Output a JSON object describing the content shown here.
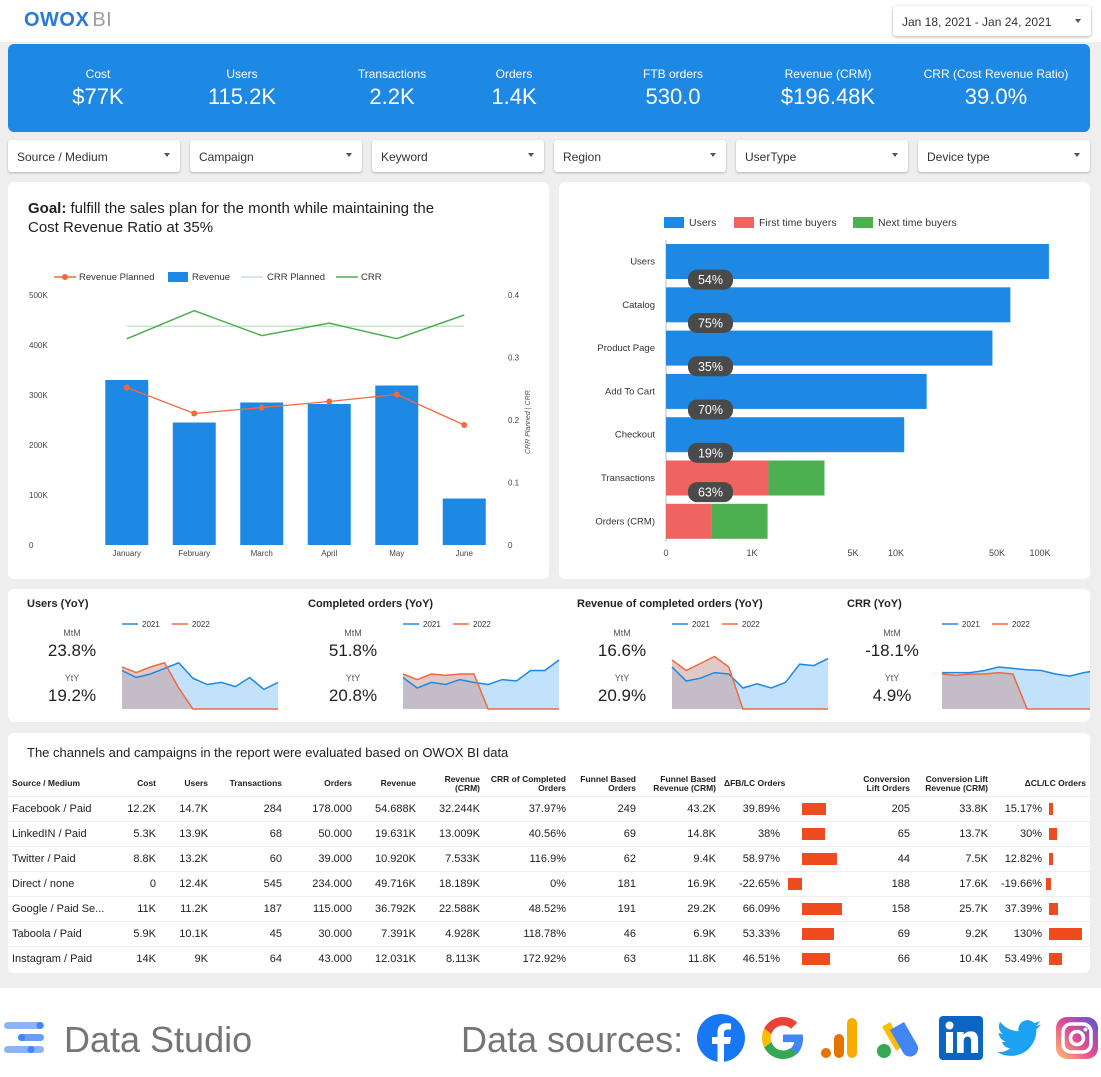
{
  "header": {
    "logo_main": "OWOX",
    "logo_sub": "BI",
    "date_range": "Jan 18, 2021 - Jan 24, 2021"
  },
  "kpis": [
    {
      "label": "Cost",
      "value": "$77K"
    },
    {
      "label": "Users",
      "value": "115.2K"
    },
    {
      "label": "Transactions",
      "value": "2.2K"
    },
    {
      "label": "Orders",
      "value": "1.4K"
    },
    {
      "label": "FTB orders",
      "value": "530.0"
    },
    {
      "label": "Revenue (CRM)",
      "value": "$196.48K"
    },
    {
      "label": "CRR (Cost Revenue Ratio)",
      "value": "39.0%"
    }
  ],
  "filters": [
    "Source / Medium",
    "Campaign",
    "Keyword",
    "Region",
    "UserType",
    "Device type"
  ],
  "goal": {
    "bold": "Goal:",
    "text": " fulfill the sales plan for the month while maintaining the Cost Revenue Ratio at 35%"
  },
  "chart_data": [
    {
      "type": "bar",
      "categories": [
        "January",
        "February",
        "March",
        "April",
        "May",
        "June"
      ],
      "series": [
        {
          "name": "Revenue",
          "type": "bar",
          "axis": "left",
          "values": [
            330000,
            245000,
            285000,
            282000,
            319000,
            93000
          ]
        },
        {
          "name": "Revenue Planned",
          "type": "line",
          "axis": "left",
          "values": [
            315000,
            263000,
            275000,
            287000,
            301000,
            240000
          ]
        },
        {
          "name": "CRR Planned",
          "type": "line",
          "axis": "right",
          "values": [
            0.35,
            0.35,
            0.35,
            0.35,
            0.35,
            0.35
          ]
        },
        {
          "name": "CRR",
          "type": "line",
          "axis": "right",
          "values": [
            0.33,
            0.375,
            0.335,
            0.355,
            0.33,
            0.368
          ]
        }
      ],
      "yticks": [
        "500K",
        "400K",
        "300K",
        "200K",
        "100K",
        "0"
      ],
      "y2ticks": [
        "0.4",
        "0.3",
        "0.2",
        "0.1",
        "0"
      ],
      "ylim": [
        0,
        500000
      ],
      "y2lim": [
        0,
        0.4
      ],
      "y2label": "CRR Planned | CRR",
      "colors": {
        "bar": "#1e88e5",
        "planned": "#f4683c",
        "crr_planned": "#c8e6c9",
        "crr": "#4caf50"
      }
    },
    {
      "type": "bar",
      "orientation": "horizontal",
      "scale": "log",
      "categories": [
        "Users",
        "Catalog",
        "Product Page",
        "Add To Cart",
        "Checkout",
        "Transactions",
        "Orders (CRM)"
      ],
      "series": [
        {
          "name": "Users",
          "values": [
            115200,
            62000,
            46500,
            16300,
            11400,
            null,
            null
          ]
        },
        {
          "name": "First time buyers",
          "values": [
            null,
            null,
            null,
            null,
            null,
            1300,
            530
          ]
        },
        {
          "name": "Next time buyers",
          "values": [
            null,
            null,
            null,
            null,
            null,
            900,
            870
          ]
        }
      ],
      "step_labels": [
        "54%",
        "75%",
        "35%",
        "70%",
        "19%",
        "63%"
      ],
      "xticks": [
        "0",
        "1K",
        "5K",
        "10K",
        "50K",
        "100K"
      ],
      "colors": {
        "users": "#1e88e5",
        "ftb": "#ef6461",
        "ntb": "#4caf50"
      }
    },
    {
      "type": "area",
      "title": "Users (YoY)",
      "series": [
        {
          "name": "2021",
          "values": [
            0.55,
            0.45,
            0.5,
            0.58,
            0.66,
            0.44,
            0.35,
            0.38,
            0.32,
            0.45,
            0.28,
            0.38
          ]
        },
        {
          "name": "2022",
          "values": [
            0.6,
            0.52,
            0.6,
            0.66,
            0.3,
            0,
            0,
            0,
            0,
            0,
            0,
            0
          ]
        }
      ]
    },
    {
      "type": "area",
      "title": "Completed orders (YoY)",
      "series": [
        {
          "name": "2021",
          "values": [
            0.45,
            0.3,
            0.38,
            0.35,
            0.42,
            0.38,
            0.35,
            0.42,
            0.4,
            0.55,
            0.55,
            0.7
          ]
        },
        {
          "name": "2022",
          "values": [
            0.5,
            0.42,
            0.5,
            0.48,
            0.5,
            0.5,
            0,
            0,
            0,
            0,
            0,
            0
          ]
        }
      ]
    },
    {
      "type": "area",
      "title": "Revenue of completed orders (YoY)",
      "series": [
        {
          "name": "2021",
          "values": [
            0.6,
            0.4,
            0.44,
            0.52,
            0.5,
            0.3,
            0.36,
            0.3,
            0.38,
            0.64,
            0.62,
            0.72
          ]
        },
        {
          "name": "2022",
          "values": [
            0.7,
            0.55,
            0.65,
            0.75,
            0.6,
            0,
            0,
            0,
            0,
            0,
            0,
            0
          ]
        }
      ]
    },
    {
      "type": "area",
      "title": "CRR (YoY)",
      "series": [
        {
          "name": "2021",
          "values": [
            0.52,
            0.52,
            0.52,
            0.55,
            0.6,
            0.58,
            0.56,
            0.55,
            0.5,
            0.47,
            0.52,
            0.55
          ]
        },
        {
          "name": "2022",
          "values": [
            0.5,
            0.48,
            0.5,
            0.5,
            0.52,
            0.5,
            0,
            0,
            0,
            0,
            0,
            0
          ]
        }
      ]
    }
  ],
  "legend": {
    "revenue_planned": "Revenue Planned",
    "revenue": "Revenue",
    "crr_planned": "CRR Planned",
    "crr": "CRR",
    "users": "Users",
    "ftb": "First time buyers",
    "ntb": "Next time buyers",
    "y2021": "2021",
    "y2022": "2022"
  },
  "yoy": [
    {
      "title": "Users (YoY)",
      "mtm_label": "MtM",
      "mtm": "23.8%",
      "yty_label": "YtY",
      "yty": "19.2%"
    },
    {
      "title": "Completed orders (YoY)",
      "mtm_label": "MtM",
      "mtm": "51.8%",
      "yty_label": "YtY",
      "yty": "20.8%"
    },
    {
      "title": "Revenue of completed orders (YoY)",
      "mtm_label": "MtM",
      "mtm": "16.6%",
      "yty_label": "YtY",
      "yty": "20.9%"
    },
    {
      "title": "CRR (YoY)",
      "mtm_label": "MtM",
      "mtm": "-18.1%",
      "yty_label": "YtY",
      "yty": "4.9%"
    }
  ],
  "table": {
    "title": "The channels and campaigns in the report were evaluated based on OWOX BI data",
    "headers": [
      "Source / Medium",
      "Cost",
      "Users",
      "Transactions",
      "Orders",
      "Revenue",
      "Revenue (CRM)",
      "CRR of Completed Orders",
      "Funnel Based Orders",
      "Funnel Based Revenue (CRM)",
      "ΔFB/LC Orders",
      "Conversion Lift Orders",
      "Conversion Lift Revenue (CRM)",
      "ΔCL/LC Orders"
    ],
    "rows": [
      {
        "source": "Facebook / Paid",
        "cost": "12.2K",
        "users": "14.7K",
        "transactions": "284",
        "orders": "178.000",
        "revenue": "54.688K",
        "revenue_crm": "32.244K",
        "crr": "37.97%",
        "fb_orders": "249",
        "fb_revenue": "43.2K",
        "dfb": "39.89%",
        "dfb_val": 39.89,
        "cl_orders": "205",
        "cl_revenue": "33.8K",
        "dcl": "15.17%",
        "dcl_val": 15.17
      },
      {
        "source": "LinkedIN / Paid",
        "cost": "5.3K",
        "users": "13.9K",
        "transactions": "68",
        "orders": "50.000",
        "revenue": "19.631K",
        "revenue_crm": "13.009K",
        "crr": "40.56%",
        "fb_orders": "69",
        "fb_revenue": "14.8K",
        "dfb": "38%",
        "dfb_val": 38,
        "cl_orders": "65",
        "cl_revenue": "13.7K",
        "dcl": "30%",
        "dcl_val": 30
      },
      {
        "source": "Twitter / Paid",
        "cost": "8.8K",
        "users": "13.2K",
        "transactions": "60",
        "orders": "39.000",
        "revenue": "10.920K",
        "revenue_crm": "7.533K",
        "crr": "116.9%",
        "fb_orders": "62",
        "fb_revenue": "9.4K",
        "dfb": "58.97%",
        "dfb_val": 58.97,
        "cl_orders": "44",
        "cl_revenue": "7.5K",
        "dcl": "12.82%",
        "dcl_val": 12.82
      },
      {
        "source": "Direct / none",
        "cost": "0",
        "users": "12.4K",
        "transactions": "545",
        "orders": "234.000",
        "revenue": "49.716K",
        "revenue_crm": "18.189K",
        "crr": "0%",
        "fb_orders": "181",
        "fb_revenue": "16.9K",
        "dfb": "-22.65%",
        "dfb_val": -22.65,
        "cl_orders": "188",
        "cl_revenue": "17.6K",
        "dcl": "-19.66%",
        "dcl_val": -19.66
      },
      {
        "source": "Google / Paid Se...",
        "cost": "11K",
        "users": "11.2K",
        "transactions": "187",
        "orders": "115.000",
        "revenue": "36.792K",
        "revenue_crm": "22.588K",
        "crr": "48.52%",
        "fb_orders": "191",
        "fb_revenue": "29.2K",
        "dfb": "66.09%",
        "dfb_val": 66.09,
        "cl_orders": "158",
        "cl_revenue": "25.7K",
        "dcl": "37.39%",
        "dcl_val": 37.39
      },
      {
        "source": "Taboola / Paid",
        "cost": "5.9K",
        "users": "10.1K",
        "transactions": "45",
        "orders": "30.000",
        "revenue": "7.391K",
        "revenue_crm": "4.928K",
        "crr": "118.78%",
        "fb_orders": "46",
        "fb_revenue": "6.9K",
        "dfb": "53.33%",
        "dfb_val": 53.33,
        "cl_orders": "69",
        "cl_revenue": "9.2K",
        "dcl": "130%",
        "dcl_val": 130
      },
      {
        "source": "Instagram / Paid",
        "cost": "14K",
        "users": "9K",
        "transactions": "64",
        "orders": "43.000",
        "revenue": "12.031K",
        "revenue_crm": "8.113K",
        "crr": "172.92%",
        "fb_orders": "63",
        "fb_revenue": "11.8K",
        "dfb": "46.51%",
        "dfb_val": 46.51,
        "cl_orders": "66",
        "cl_revenue": "10.4K",
        "dcl": "53.49%",
        "dcl_val": 53.49
      }
    ]
  },
  "footer": {
    "product": "Data Studio",
    "sources_label": "Data sources:",
    "icons": [
      "facebook-icon",
      "google-icon",
      "google-analytics-icon",
      "google-ads-icon",
      "linkedin-icon",
      "twitter-icon",
      "instagram-icon"
    ]
  },
  "colors": {
    "accent": "#1e88e5",
    "orange": "#f4683c",
    "green": "#4caf50",
    "red": "#ef6461",
    "yoy_2021_fill": "#bbdefb",
    "yoy_2022_fill": "#e0b8b4",
    "bar_red": "#ee4b1f"
  }
}
